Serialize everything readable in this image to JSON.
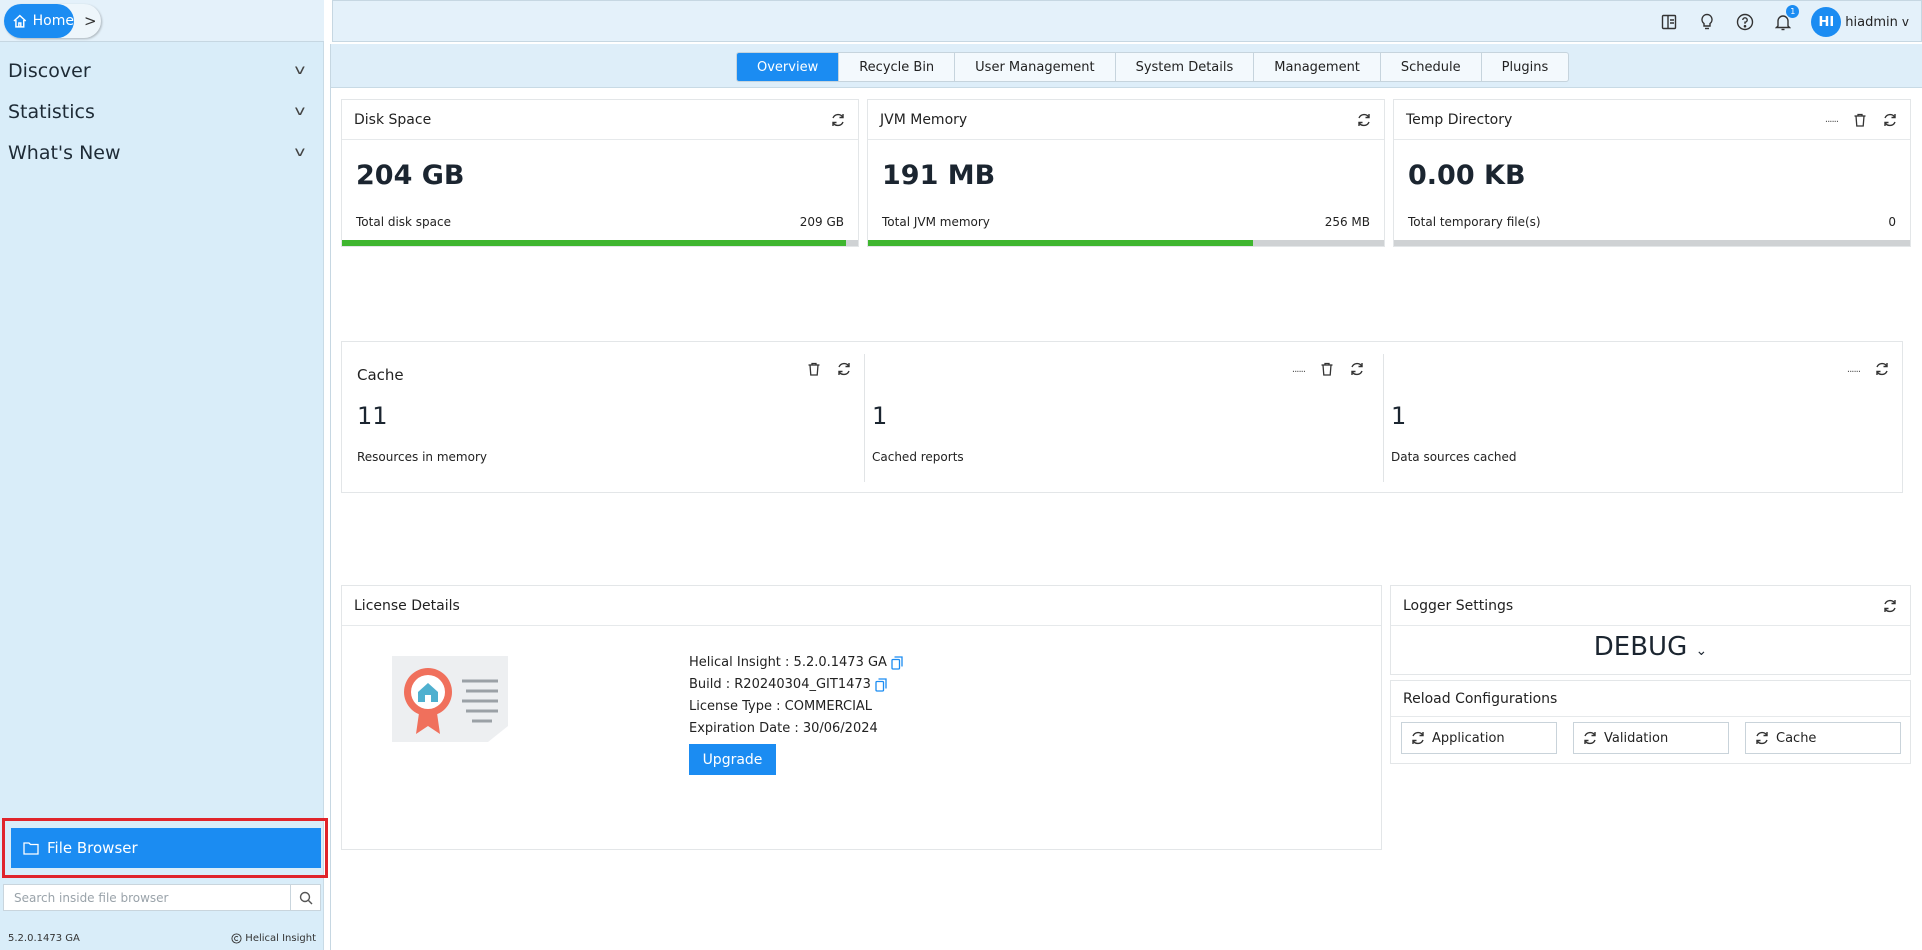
{
  "sidebar": {
    "home_label": "Home",
    "nav_items": [
      {
        "label": "Discover"
      },
      {
        "label": "Statistics"
      },
      {
        "label": "What's New"
      }
    ],
    "file_browser_label": "File Browser",
    "search_placeholder": "Search inside file browser",
    "version": "5.2.0.1473 GA",
    "brand": "Helical Insight"
  },
  "topbar": {
    "notification_count": "1",
    "user_initials": "HI",
    "user_name": "hiadmin"
  },
  "tabs": [
    "Overview",
    "Recycle Bin",
    "User Management",
    "System Details",
    "Management",
    "Schedule",
    "Plugins"
  ],
  "active_tab": "Overview",
  "disk_space": {
    "title": "Disk Space",
    "value": "204 GB",
    "label": "Total disk space",
    "total": "209 GB",
    "fill_fraction": 0.976
  },
  "jvm_memory": {
    "title": "JVM Memory",
    "value": "191 MB",
    "label": "Total JVM memory",
    "total": "256 MB",
    "fill_fraction": 0.746
  },
  "temp_directory": {
    "title": "Temp Directory",
    "value": "0.00 KB",
    "label": "Total temporary file(s)",
    "total": "0",
    "fill_fraction": 0
  },
  "cache": {
    "title": "Cache",
    "resources_value": "11",
    "resources_label": "Resources in memory",
    "reports_value": "1",
    "reports_label": "Cached reports",
    "datasources_value": "1",
    "datasources_label": "Data sources cached"
  },
  "license": {
    "title": "License Details",
    "product": "Helical Insight : 5.2.0.1473 GA",
    "build": "Build : R20240304_GIT1473",
    "type": "License Type : COMMERCIAL",
    "expiration": "Expiration Date : 30/06/2024",
    "upgrade_label": "Upgrade"
  },
  "logger": {
    "title": "Logger Settings",
    "level": "DEBUG"
  },
  "reload": {
    "title": "Reload Configurations",
    "buttons": [
      "Application",
      "Validation",
      "Cache"
    ]
  },
  "colors": {
    "primary": "#1b8cf2",
    "bar_fill": "#3fb62f",
    "highlight_border": "#e0242b",
    "sidebar_bg": "#d9edf9"
  }
}
